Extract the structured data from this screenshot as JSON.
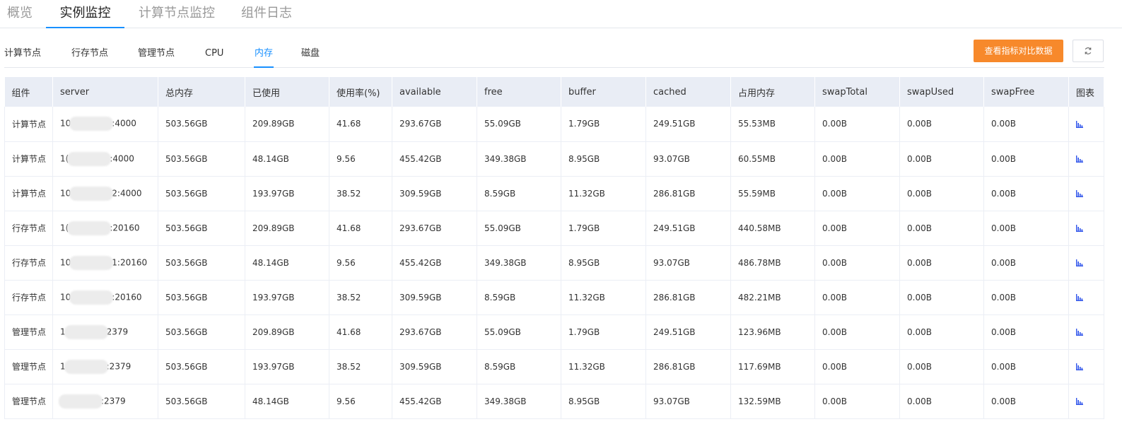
{
  "top_tabs": [
    {
      "label": "概览",
      "active": false
    },
    {
      "label": "实例监控",
      "active": true
    },
    {
      "label": "计算节点监控",
      "active": false
    },
    {
      "label": "组件日志",
      "active": false
    }
  ],
  "sub_tabs": [
    {
      "label": "计算节点",
      "active": false
    },
    {
      "label": "行存节点",
      "active": false
    },
    {
      "label": "管理节点",
      "active": false
    },
    {
      "label": "CPU",
      "active": false
    },
    {
      "label": "内存",
      "active": true
    },
    {
      "label": "磁盘",
      "active": false
    }
  ],
  "toolbar": {
    "compare_label": "查看指标对比数据",
    "refresh_icon": "refresh-icon",
    "accent_color": "#f7892b"
  },
  "table": {
    "headers": [
      "组件",
      "server",
      "总内存",
      "已使用",
      "使用率(%)",
      "available",
      "free",
      "buffer",
      "cached",
      "占用内存",
      "swapTotal",
      "swapUsed",
      "swapFree",
      "图表"
    ],
    "chart_icon": "bar-chart-icon",
    "rows": [
      {
        "component": "计算节点",
        "server_prefix": "10",
        "server_suffix": ":4000",
        "total": "503.56GB",
        "used": "209.89GB",
        "rate": "41.68",
        "available": "293.67GB",
        "free": "55.09GB",
        "buffer": "1.79GB",
        "cached": "249.51GB",
        "occupied": "55.53MB",
        "swapTotal": "0.00B",
        "swapUsed": "0.00B",
        "swapFree": "0.00B"
      },
      {
        "component": "计算节点",
        "server_prefix": "1(",
        "server_suffix": ":4000",
        "total": "503.56GB",
        "used": "48.14GB",
        "rate": "9.56",
        "available": "455.42GB",
        "free": "349.38GB",
        "buffer": "8.95GB",
        "cached": "93.07GB",
        "occupied": "60.55MB",
        "swapTotal": "0.00B",
        "swapUsed": "0.00B",
        "swapFree": "0.00B"
      },
      {
        "component": "计算节点",
        "server_prefix": "10",
        "server_suffix": "2:4000",
        "total": "503.56GB",
        "used": "193.97GB",
        "rate": "38.52",
        "available": "309.59GB",
        "free": "8.59GB",
        "buffer": "11.32GB",
        "cached": "286.81GB",
        "occupied": "55.59MB",
        "swapTotal": "0.00B",
        "swapUsed": "0.00B",
        "swapFree": "0.00B"
      },
      {
        "component": "行存节点",
        "server_prefix": "1(",
        "server_suffix": ":20160",
        "total": "503.56GB",
        "used": "209.89GB",
        "rate": "41.68",
        "available": "293.67GB",
        "free": "55.09GB",
        "buffer": "1.79GB",
        "cached": "249.51GB",
        "occupied": "440.58MB",
        "swapTotal": "0.00B",
        "swapUsed": "0.00B",
        "swapFree": "0.00B"
      },
      {
        "component": "行存节点",
        "server_prefix": "10",
        "server_suffix": "1:20160",
        "total": "503.56GB",
        "used": "48.14GB",
        "rate": "9.56",
        "available": "455.42GB",
        "free": "349.38GB",
        "buffer": "8.95GB",
        "cached": "93.07GB",
        "occupied": "486.78MB",
        "swapTotal": "0.00B",
        "swapUsed": "0.00B",
        "swapFree": "0.00B"
      },
      {
        "component": "行存节点",
        "server_prefix": "10",
        "server_suffix": ":20160",
        "total": "503.56GB",
        "used": "193.97GB",
        "rate": "38.52",
        "available": "309.59GB",
        "free": "8.59GB",
        "buffer": "11.32GB",
        "cached": "286.81GB",
        "occupied": "482.21MB",
        "swapTotal": "0.00B",
        "swapUsed": "0.00B",
        "swapFree": "0.00B"
      },
      {
        "component": "管理节点",
        "server_prefix": "1",
        "server_suffix": "2379",
        "total": "503.56GB",
        "used": "209.89GB",
        "rate": "41.68",
        "available": "293.67GB",
        "free": "55.09GB",
        "buffer": "1.79GB",
        "cached": "249.51GB",
        "occupied": "123.96MB",
        "swapTotal": "0.00B",
        "swapUsed": "0.00B",
        "swapFree": "0.00B"
      },
      {
        "component": "管理节点",
        "server_prefix": "1",
        "server_suffix": ":2379",
        "total": "503.56GB",
        "used": "193.97GB",
        "rate": "38.52",
        "available": "309.59GB",
        "free": "8.59GB",
        "buffer": "11.32GB",
        "cached": "286.81GB",
        "occupied": "117.69MB",
        "swapTotal": "0.00B",
        "swapUsed": "0.00B",
        "swapFree": "0.00B"
      },
      {
        "component": "管理节点",
        "server_prefix": "",
        "server_suffix": ":2379",
        "total": "503.56GB",
        "used": "48.14GB",
        "rate": "9.56",
        "available": "455.42GB",
        "free": "349.38GB",
        "buffer": "8.95GB",
        "cached": "93.07GB",
        "occupied": "132.59MB",
        "swapTotal": "0.00B",
        "swapUsed": "0.00B",
        "swapFree": "0.00B"
      }
    ]
  }
}
